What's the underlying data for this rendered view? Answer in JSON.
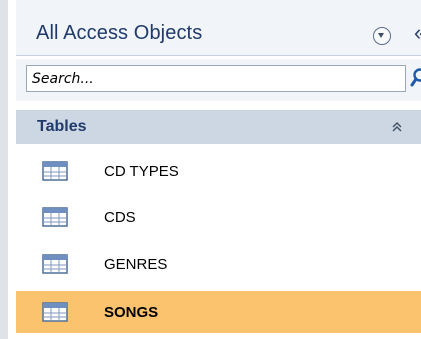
{
  "nav_pane": {
    "title": "All Access Objects",
    "search": {
      "placeholder": "Search...",
      "value": ""
    },
    "group": {
      "label": "Tables"
    },
    "items": [
      {
        "label": "CD TYPES",
        "icon": "table-icon",
        "selected": false
      },
      {
        "label": "CDS",
        "icon": "table-icon",
        "selected": false
      },
      {
        "label": "GENRES",
        "icon": "table-icon",
        "selected": false
      },
      {
        "label": "SONGS",
        "icon": "table-icon",
        "selected": true
      }
    ]
  },
  "colors": {
    "header_bg": "#f1f4f8",
    "group_bg": "#cdd7e3",
    "selected_bg": "#fcc36f",
    "title_text": "#1f3a6b"
  }
}
